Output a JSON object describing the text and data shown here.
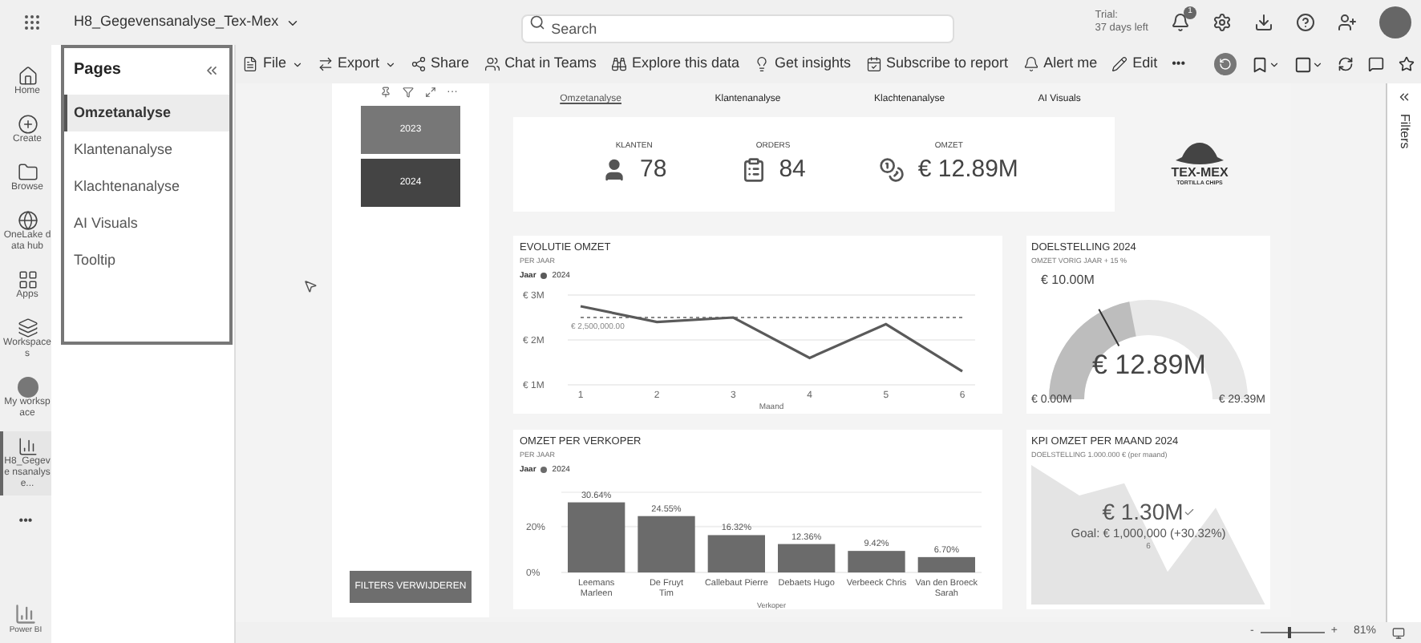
{
  "topbar": {
    "title": "H8_Gegevensanalyse_Tex-Mex",
    "search": {
      "placeholder": "Search"
    },
    "trial": [
      "Trial:",
      "37 days left"
    ],
    "notifications": "1"
  },
  "rail": [
    {
      "label": "Home",
      "selected": false
    },
    {
      "label": "Create",
      "selected": false
    },
    {
      "label": "Browse",
      "selected": false
    },
    {
      "label": "OneLake data hub",
      "selected": false
    },
    {
      "label": "Apps",
      "selected": false
    },
    {
      "label": "Workspaces",
      "selected": false
    },
    {
      "label": "My workspace",
      "selected": false
    },
    {
      "label": "H8_Gegeve nsanalyse...",
      "selected": true
    }
  ],
  "rail_more": "•••",
  "rail_brand": "Power BI",
  "toolbar": [
    {
      "label": "File",
      "kind": "menu"
    },
    {
      "label": "Export",
      "kind": "menu"
    },
    {
      "label": "Share",
      "kind": "action"
    },
    {
      "label": "Chat in Teams",
      "kind": "action"
    },
    {
      "label": "Explore this data",
      "kind": "action"
    },
    {
      "label": "Get insights",
      "kind": "action"
    },
    {
      "label": "Subscribe to report",
      "kind": "action"
    },
    {
      "label": "Alert me",
      "kind": "action"
    },
    {
      "label": "Edit",
      "kind": "action"
    }
  ],
  "toolbar_more": "•••",
  "pages": {
    "title": "Pages",
    "items": [
      {
        "label": "Omzetanalyse",
        "selected": true
      },
      {
        "label": "Klantenanalyse",
        "selected": false
      },
      {
        "label": "Klachtenanalyse",
        "selected": false
      },
      {
        "label": "AI Visuals",
        "selected": false
      },
      {
        "label": "Tooltip",
        "selected": false
      }
    ]
  },
  "report": {
    "slicer": {
      "more": "···",
      "items": [
        {
          "label": "2023",
          "selected": false
        },
        {
          "label": "2024",
          "selected": true
        }
      ]
    },
    "clear_button": "FILTERS VERWIJDEREN",
    "nav": [
      {
        "label": "Omzetanalyse",
        "selected": true
      },
      {
        "label": "Klantenanalyse",
        "selected": false
      },
      {
        "label": "Klachtenanalyse",
        "selected": false
      },
      {
        "label": "AI Visuals",
        "selected": false
      }
    ],
    "cards": [
      {
        "label": "KLANTEN",
        "value": "78"
      },
      {
        "label": "ORDERS",
        "value": "84"
      },
      {
        "label": "OMZET",
        "value": "€ 12.89M"
      }
    ],
    "logo": {
      "top": "TEX-MEX",
      "bottom": "TORTILLA CHIPS"
    },
    "evolutie": {
      "title": "EVOLUTIE OMZET",
      "subtitle": "PER JAAR",
      "legend_title": "Jaar",
      "chart_data": {
        "type": "line",
        "xlabel": "Maand",
        "categories": [
          "1",
          "2",
          "3",
          "4",
          "5",
          "6"
        ],
        "series": [
          {
            "name": "2024",
            "color": "#5a5a5a",
            "values": [
              2.75,
              2.4,
              2.5,
              1.6,
              2.35,
              1.3
            ]
          },
          {
            "name": "€ 2,500,000.00",
            "color": "#888888",
            "line_style": "dashed",
            "values": [
              2.5,
              2.5,
              2.5,
              2.5,
              2.5,
              2.5
            ]
          }
        ],
        "ylim": [
          1,
          3
        ],
        "yticks": [
          {
            "value": 1,
            "label": "€ 1M"
          },
          {
            "value": 2,
            "label": "€ 2M"
          },
          {
            "value": 3,
            "label": "€ 3M"
          }
        ]
      }
    },
    "doelstelling": {
      "title": "DOELSTELLING 2024",
      "subtitle": "OMZET VORIG JAAR + 15 %",
      "target": "€ 10.00M",
      "value": "€ 12.89M",
      "min": "€ 0.00M",
      "max": "€ 29.39M",
      "level": 0.4386
    },
    "verkoper": {
      "title": "OMZET PER VERKOPER",
      "subtitle": "PER JAAR",
      "legend_title": "Jaar",
      "chart_data": {
        "type": "bar",
        "xlabel": "Verkoper",
        "categories": [
          "Leemans Marleen",
          "De Fruyt Tim",
          "Callebaut Pierre",
          "Debaets Hugo",
          "Verbeeck Chris",
          "Van den Broeck Sarah"
        ],
        "series": [
          {
            "name": "2024",
            "color": "#6b6b6b",
            "values": [
              30.6,
              24.6,
              16.3,
              12.4,
              9.4,
              6.7
            ]
          }
        ],
        "ylim": [
          0,
          35
        ],
        "yticks": [
          {
            "value": 0,
            "label": "0%"
          },
          {
            "value": 20,
            "label": "20%"
          }
        ],
        "value_labels": [
          "30.64%",
          "24.55%",
          "16.32%",
          "12.36%",
          "9.42%",
          "6.70%"
        ]
      }
    },
    "kpi": {
      "title": "KPI OMZET PER MAAND 2024",
      "subtitle": "DOELSTELLING 1.000.000 € (per maand)",
      "value": "€ 1.30M",
      "goal": "Goal: € 1,000,000 (+30.32%)",
      "period": "6"
    }
  },
  "filters": {
    "label": "Filters"
  },
  "status": {
    "minus": "-",
    "plus": "+",
    "zoom": {
      "level": 0.42,
      "reading": "81%"
    }
  }
}
